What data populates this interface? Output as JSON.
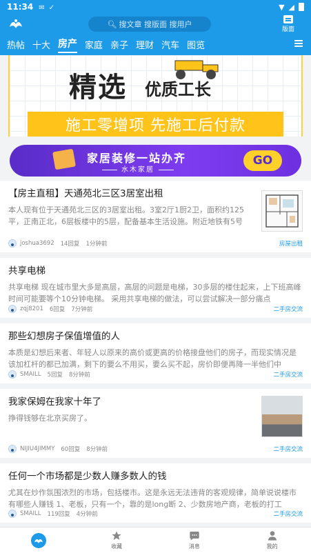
{
  "status": {
    "time": "11:34"
  },
  "header": {
    "search_placeholder": "搜文章 搜版面 搜用户",
    "banmian_label": "版面"
  },
  "tabs": [
    "热帖",
    "十大",
    "房产",
    "家庭",
    "亲子",
    "理财",
    "汽车",
    "图览"
  ],
  "active_tab": "房产",
  "banner1": {
    "headline": "精选",
    "subline": "优质工长",
    "strip": "施工零增项  先施工后付款"
  },
  "banner2": {
    "line1": "家居装修一站办齐",
    "line2": "水木家居",
    "go": "GO"
  },
  "posts": [
    {
      "title": "【房主直租】天通苑北三区3居室出租",
      "excerpt": "本人现有位于天通苑北三区的3居室出租。3室2厅1厨2卫，面积约125平，正南正北，6层板楼中的5层，配备基本生活设施。附近地铁有5号",
      "author": "joshua3692",
      "replies": "14回复",
      "time": "1分钟前",
      "tag": "房屋出租"
    },
    {
      "title": "共享电梯",
      "excerpt": "共享电梯 现在城市里大多是高层，高层的问题是电梯，30多层的楼住起来，上下班高峰时间可能要等个10分钟电梯。 采用共享电梯的做法，可以尝试解决一部分痛点",
      "author": "zqj8201",
      "replies": "6回复",
      "time": "7分钟前",
      "tag": "二手房交流"
    },
    {
      "title": "那些幻想房子保值增值的人",
      "excerpt": "本质是幻想后来者、年轻人以原来的高价或更高的价格接盘他们的房子，而现实情况是该加杠杆的都已加满，剩下的要么不用买，要么买不起，房价即便再降一半他们中",
      "author": "SMAILL",
      "replies": "5回复",
      "time": "8分钟前",
      "tag": "二手房交流"
    },
    {
      "title": "我家保姆在我家十年了",
      "excerpt": "挣得钱够在北京买房了。",
      "author": "NIJIU4JIMMY",
      "replies": "60回复",
      "time": "8分钟前",
      "tag": "二手房交流"
    },
    {
      "title": "任何一个市场都是少数人赚多数人的钱",
      "excerpt": "尤其在炒作氛围浓烈的市场，包括楼市。这是永远无法违背的客观规律，简单说说楼市有哪些人赚钱 1、老板，只有一个，靠的是long断 2、少数房地产商，老板的打工",
      "author": "SMAILL",
      "replies": "119回复",
      "time": "4分钟前",
      "tag": "二手房交流"
    }
  ],
  "bottomnav": {
    "fav": "收藏",
    "msg": "消息",
    "me": "我的"
  },
  "colors": {
    "brand": "#1e9be8",
    "banner_yellow": "#ffc31a",
    "banner_purple": "#6d30e0"
  }
}
